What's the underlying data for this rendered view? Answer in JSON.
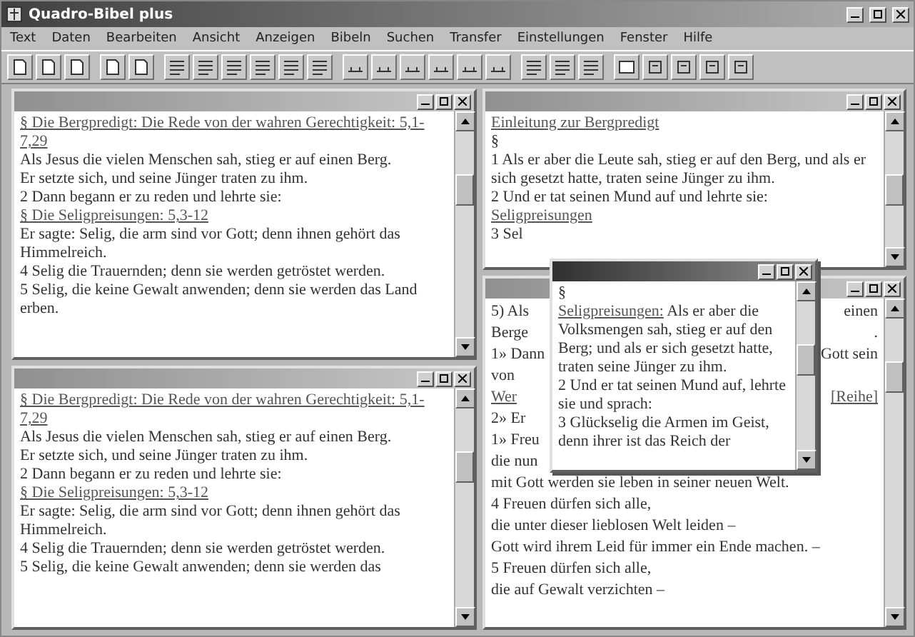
{
  "window": {
    "title": "Quadro-Bibel plus"
  },
  "menu": [
    "Text",
    "Daten",
    "Bearbeiten",
    "Ansicht",
    "Anzeigen",
    "Bibeln",
    "Suchen",
    "Transfer",
    "Einstellungen",
    "Fenster",
    "Hilfe"
  ],
  "panes": {
    "top_left": {
      "active": false,
      "lines": [
        {
          "kind": "link",
          "text": "§ Die Bergpredigt: Die Rede von der wahren Gerechtigkeit: 5,1-7,29"
        },
        {
          "kind": "text",
          "text": "Als Jesus die vielen Menschen sah, stieg er auf einen Berg."
        },
        {
          "kind": "text",
          "text": "Er setzte sich, und seine Jünger traten zu ihm."
        },
        {
          "kind": "text",
          "text": "2 Dann begann er zu reden und lehrte sie:"
        },
        {
          "kind": "link",
          "text": "§ Die Seligpreisungen: 5,3-12"
        },
        {
          "kind": "text",
          "text": "Er sagte: Selig, die arm sind vor Gott; denn ihnen gehört das Himmelreich."
        },
        {
          "kind": "text",
          "text": "4 Selig die Trauernden; denn sie werden getröstet werden."
        },
        {
          "kind": "text",
          "text": "5 Selig, die keine Gewalt anwenden; denn sie werden das Land erben."
        }
      ]
    },
    "bottom_left": {
      "active": false,
      "lines": [
        {
          "kind": "link",
          "text": "§ Die Bergpredigt: Die Rede von der wahren Gerechtigkeit: 5,1-7,29"
        },
        {
          "kind": "text",
          "text": "Als Jesus die vielen Menschen sah, stieg er auf einen Berg."
        },
        {
          "kind": "text",
          "text": "Er setzte sich, und seine Jünger traten zu ihm."
        },
        {
          "kind": "text",
          "text": "2 Dann begann er zu reden und lehrte sie:"
        },
        {
          "kind": "link",
          "text": "§ Die Seligpreisungen: 5,3-12"
        },
        {
          "kind": "text",
          "text": "Er sagte: Selig, die arm sind vor Gott; denn ihnen gehört das Himmelreich."
        },
        {
          "kind": "text",
          "text": "4 Selig die Trauernden; denn sie werden getröstet werden."
        },
        {
          "kind": "text",
          "text": "5 Selig, die keine Gewalt anwenden; denn sie werden das"
        }
      ]
    },
    "top_right": {
      "active": false,
      "lines": [
        {
          "kind": "link",
          "text": "Einleitung zur Bergpredigt"
        },
        {
          "kind": "text",
          "text": "§"
        },
        {
          "kind": "text",
          "text": "1 Als er aber die Leute sah, stieg er auf den Berg, und als er sich gesetzt hatte, traten seine Jünger zu ihm."
        },
        {
          "kind": "text",
          "text": "2 Und er tat seinen Mund auf und lehrte sie:"
        },
        {
          "kind": "link",
          "text": "Seligpreisungen"
        },
        {
          "kind": "text",
          "text": "3 Sel"
        }
      ]
    },
    "bottom_right": {
      "active": false,
      "lines": [
        {
          "kind": "text",
          "start": "5) Als",
          "end": "einen"
        },
        {
          "kind": "text",
          "start": "Berge",
          "end": "."
        },
        {
          "kind": "text",
          "start": "1» Dann",
          "end": "Gott sein"
        },
        {
          "kind": "text",
          "start": "von"
        },
        {
          "kind": "link",
          "start": "Wer",
          "end": "[Reihe]"
        },
        {
          "kind": "text",
          "start": "2» Er"
        },
        {
          "kind": "text",
          "start": "1» Freu"
        },
        {
          "kind": "text",
          "start": "die nun"
        },
        {
          "kind": "text",
          "start": "mit Gott werden sie leben in seiner neuen Welt."
        },
        {
          "kind": "text",
          "start": "4 Freuen dürfen sich alle,"
        },
        {
          "kind": "text",
          "start": "die unter dieser lieblosen Welt leiden –"
        },
        {
          "kind": "text",
          "start": "Gott wird ihrem Leid für immer ein Ende machen. –"
        },
        {
          "kind": "text",
          "start": "5 Freuen dürfen sich alle,"
        },
        {
          "kind": "text",
          "start": "die auf Gewalt verzichten –"
        }
      ]
    }
  },
  "popup": {
    "active": true,
    "lines": [
      {
        "kind": "text",
        "text": "§"
      },
      {
        "kind": "mixed",
        "link": "Seligpreisungen:",
        "text": "Als er aber die Volksmengen sah, stieg er auf den Berg; und als er sich gesetzt hatte, traten seine Jünger zu ihm."
      },
      {
        "kind": "text",
        "text": "2 Und er tat seinen Mund auf, lehrte sie und sprach:"
      },
      {
        "kind": "text",
        "text": "3 Glückselig die Armen im Geist, denn ihrer ist das Reich der"
      }
    ]
  }
}
